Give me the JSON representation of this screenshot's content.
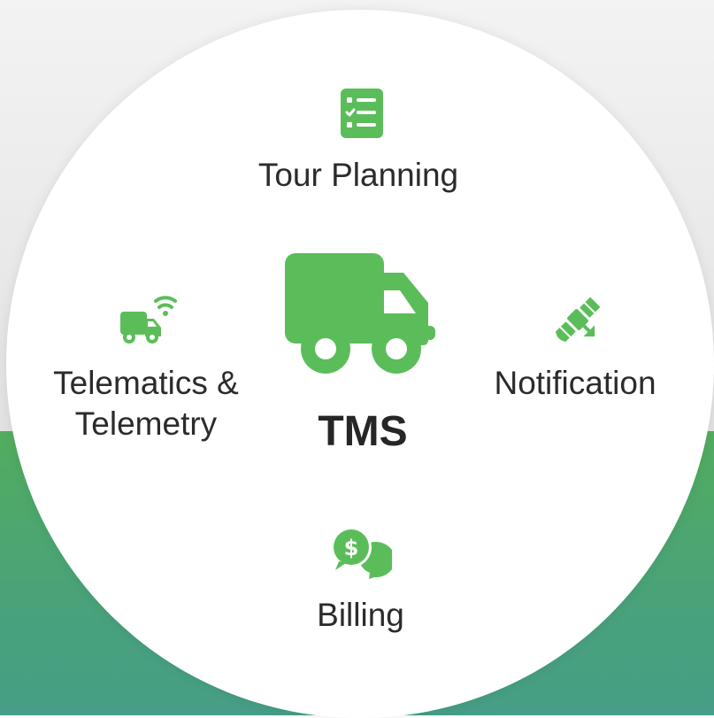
{
  "diagram": {
    "center": {
      "title": "TMS",
      "icon": "truck-icon"
    },
    "nodes": [
      {
        "id": "tour-planning",
        "label": "Tour Planning",
        "icon": "checklist-icon"
      },
      {
        "id": "telematics",
        "label_line1": "Telematics &",
        "label_line2": "Telemetry",
        "icon": "wifi-truck-icon"
      },
      {
        "id": "notification",
        "label": "Notification",
        "icon": "satellite-icon"
      },
      {
        "id": "billing",
        "label": "Billing",
        "icon": "chat-dollar-icon"
      }
    ]
  },
  "colors": {
    "accent_green": "#5bbd5a",
    "background_top": "#ececec",
    "background_bottom": "#4ca570",
    "circle": "#ffffff",
    "text": "#2b2b2b"
  }
}
